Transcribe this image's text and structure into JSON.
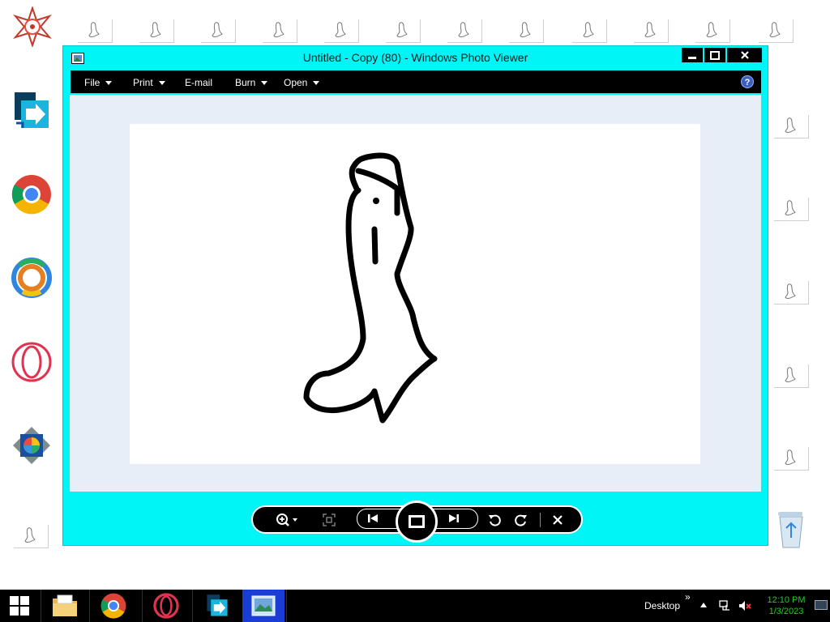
{
  "window": {
    "title": "Untitled - Copy (80) - Windows Photo Viewer"
  },
  "menu": {
    "items": [
      {
        "label": "File",
        "has_dropdown": true
      },
      {
        "label": "Print",
        "has_dropdown": true
      },
      {
        "label": "E-mail",
        "has_dropdown": false
      },
      {
        "label": "Burn",
        "has_dropdown": true
      },
      {
        "label": "Open",
        "has_dropdown": true
      }
    ],
    "help_icon": "question-mark-icon"
  },
  "controls": {
    "icons": [
      "zoom-icon",
      "actual-size-icon",
      "previous-icon",
      "slideshow-icon",
      "next-icon",
      "rotate-counterclockwise-icon",
      "rotate-clockwise-icon",
      "delete-icon"
    ]
  },
  "desktop": {
    "icons": [
      "star-logo-icon",
      "remote-desktop-icon",
      "chrome-icon",
      "colorful-app-icon",
      "opera-icon",
      "photo-gallery-icon",
      "recycle-bin-icon"
    ]
  },
  "taskbar": {
    "desktop_label": "Desktop",
    "overflow_label": "»",
    "time": "12:10 PM",
    "date": "1/3/2023",
    "apps": [
      "start-icon",
      "file-explorer-icon",
      "chrome-icon",
      "opera-icon",
      "remote-desktop-icon",
      "photo-viewer-icon"
    ]
  },
  "colors": {
    "window_frame": "#00f6f6",
    "clock": "#1fd11f"
  }
}
